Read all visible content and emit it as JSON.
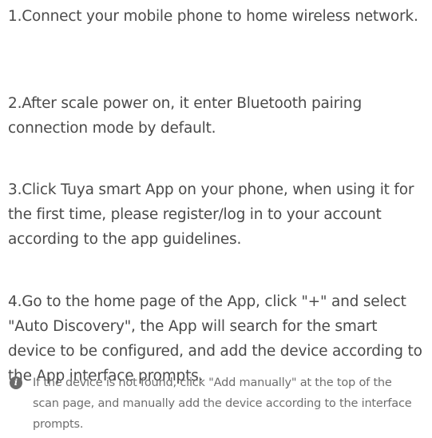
{
  "steps": [
    "1.Connect your mobile phone to home wireless network.",
    "2.After scale power on, it enter Bluetooth pairing connection mode by default.",
    "3.Click Tuya smart App on your phone, when using it for the first time, please register/log in to your account according to the app guidelines.",
    "4.Go to the home page of the App, click \"+\" and select \"Auto Discovery\", the App will search for the smart device to be configured, and add the device according to the App interface prompts."
  ],
  "note": {
    "icon": "info-icon",
    "text": "If the device is not found, click \"Add manually\" at the top of the scan page, and manually add the device according to the interface prompts."
  }
}
